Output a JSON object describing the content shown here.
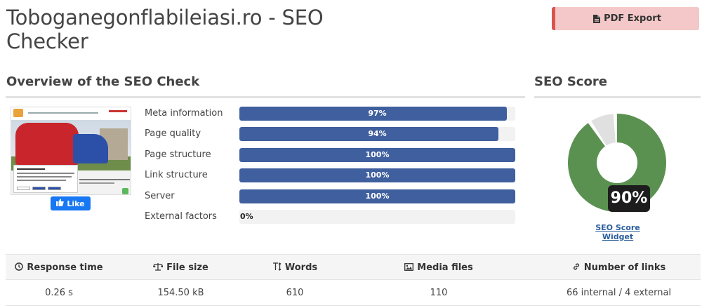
{
  "header": {
    "title": "Toboganegonflabileiasi.ro - SEO Checker",
    "pdf_label": "PDF Export"
  },
  "overview": {
    "heading": "Overview of the SEO Check",
    "like_label": "Like",
    "metrics": [
      {
        "label": "Meta information",
        "value_text": "97%",
        "value": 97
      },
      {
        "label": "Page quality",
        "value_text": "94%",
        "value": 94
      },
      {
        "label": "Page structure",
        "value_text": "100%",
        "value": 100
      },
      {
        "label": "Link structure",
        "value_text": "100%",
        "value": 100
      },
      {
        "label": "Server",
        "value_text": "100%",
        "value": 100
      },
      {
        "label": "External factors",
        "value_text": "0%",
        "value": 0
      }
    ]
  },
  "score": {
    "heading": "SEO Score",
    "value_text": "90%",
    "value": 90,
    "widget_link": "SEO Score Widget",
    "colors": {
      "good": "#5b9150",
      "rest": "#e0e0e0"
    }
  },
  "stats": {
    "headers": [
      "Response time",
      "File size",
      "Words",
      "Media files",
      "Number of links"
    ],
    "icons": [
      "clock-icon",
      "balance-scale-icon",
      "text-height-icon",
      "image-icon",
      "link-icon"
    ],
    "values": [
      "0.26 s",
      "154.50 kB",
      "610",
      "110",
      "66 internal / 4 external"
    ]
  },
  "colors": {
    "bar": "#3f5f9e",
    "pdf_bg": "#f4c8c8",
    "pdf_accent": "#d9534f",
    "like": "#1877f2"
  }
}
